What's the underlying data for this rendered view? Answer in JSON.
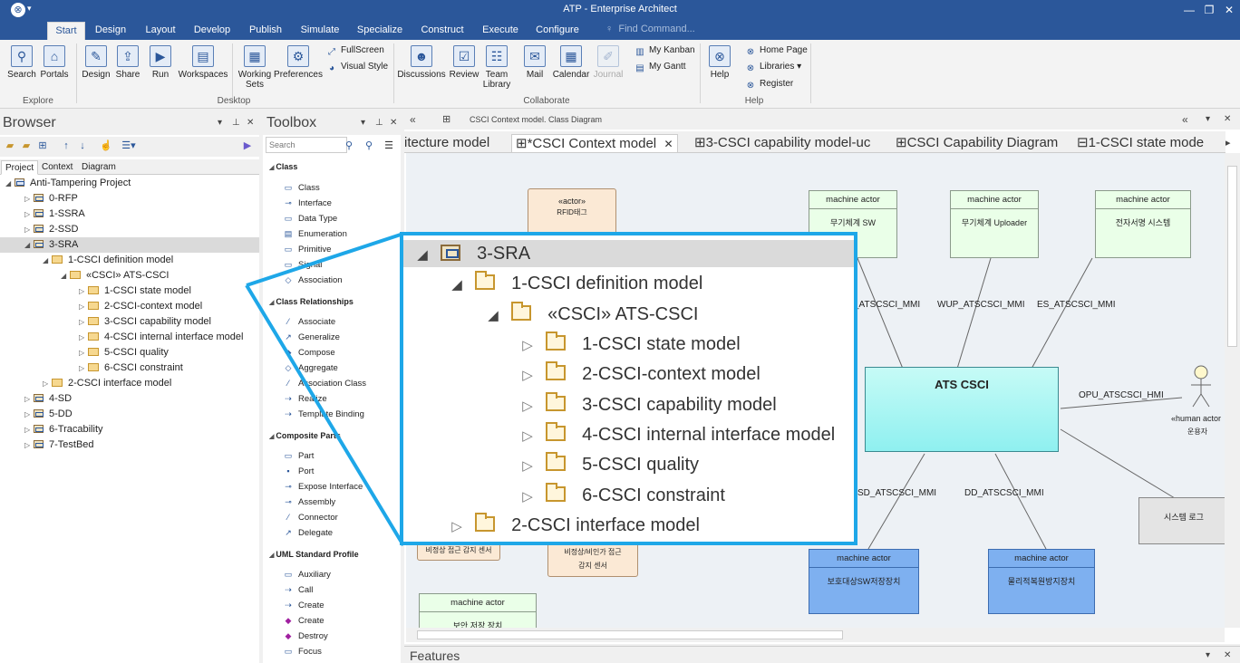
{
  "app": {
    "title": "ATP - Enterprise Architect",
    "find_placeholder": "Find Command...",
    "app_menu_icon": "ea-logo-icon"
  },
  "ribbon_tabs": [
    "Start",
    "Design",
    "Layout",
    "Develop",
    "Publish",
    "Simulate",
    "Specialize",
    "Construct",
    "Execute",
    "Configure"
  ],
  "ribbon": {
    "explore": {
      "label": "Explore",
      "search": "Search",
      "portals": "Portals"
    },
    "desktop": {
      "label": "Desktop",
      "design": "Design",
      "share": "Share",
      "run": "Run",
      "workspaces": "Workspaces",
      "working_sets": "Working Sets",
      "preferences": "Preferences",
      "fullscreen": "FullScreen",
      "visual_style": "Visual Style"
    },
    "collaborate": {
      "label": "Collaborate",
      "discussions": "Discussions",
      "review": "Review",
      "team_library": "Team Library",
      "mail": "Mail",
      "calendar": "Calendar",
      "journal": "Journal",
      "my_kanban": "My Kanban",
      "my_gantt": "My Gantt"
    },
    "help": {
      "label": "Help",
      "help": "Help",
      "home_page": "Home Page",
      "libraries": "Libraries",
      "register": "Register"
    }
  },
  "browser": {
    "title": "Browser",
    "tabs": [
      "Project",
      "Context",
      "Diagram"
    ],
    "tree": {
      "root": "Anti-Tampering Project",
      "rfp": "0-RFP",
      "ssra": "1-SSRA",
      "ssd": "2-SSD",
      "sra": "3-SRA",
      "csci_def": "1-CSCI definition model",
      "ats_csci": "«CSCI» ATS-CSCI",
      "state": "1-CSCI state model",
      "context": "2-CSCI-context model",
      "capability": "3-CSCI capability model",
      "internal": "4-CSCI internal interface model",
      "quality": "5-CSCI quality",
      "constraint": "6-CSCI constraint",
      "csci_if": "2-CSCI interface model",
      "sd": "4-SD",
      "dd": "5-DD",
      "trace": "6-Tracability",
      "testbed": "7-TestBed"
    }
  },
  "toolbox": {
    "title": "Toolbox",
    "search_placeholder": "Search",
    "sections": {
      "class": {
        "title": "Class",
        "items": [
          "Class",
          "Interface",
          "Data Type",
          "Enumeration",
          "Primitive",
          "Signal",
          "Association"
        ]
      },
      "class_rel": {
        "title": "Class Relationships",
        "items": [
          "Associate",
          "Generalize",
          "Compose",
          "Aggregate",
          "Association Class",
          "Realize",
          "Template Binding"
        ]
      },
      "composite": {
        "title": "Composite Parts",
        "items": [
          "Part",
          "Port",
          "Expose Interface",
          "Assembly",
          "Connector",
          "Delegate"
        ]
      },
      "uml": {
        "title": "UML Standard Profile",
        "items": [
          "Auxiliary",
          "Call",
          "Create",
          "Create",
          "Destroy",
          "Focus"
        ]
      }
    }
  },
  "diagram": {
    "breadcrumb": "CSCI Context model.  Class Diagram",
    "tabs": [
      "itecture model",
      "*CSCI Context model",
      "3-CSCI capability model-uc",
      "CSCI Capability Diagram",
      "1-CSCI state mode"
    ],
    "elements": {
      "actor_rfid_stereo": "«actor»",
      "actor_rfid_name": "RFID태그",
      "ma1_stereo": "machine actor",
      "ma1_name": "무기체계 SW",
      "ma2_stereo": "machine actor",
      "ma2_name": "무기체계 Uploader",
      "ma3_stereo": "machine actor",
      "ma3_name": "전자서명 시스템",
      "ats": "ATS CSCI",
      "human_actor": "«human actor",
      "human_name": "운용자",
      "log_box": "시스템 로그",
      "sensor1": "비정상 접근 감지 센서",
      "sensor2_l1": "비정상/비인가 접근",
      "sensor2_l2": "감지 센서",
      "ma4_stereo": "machine actor",
      "ma4_name": "보호대상SW저장장치",
      "ma5_stereo": "machine actor",
      "ma5_name": "물리적복원방지장치",
      "ma6_stereo": "machine actor",
      "ma6_name": "보안 저장 장치",
      "conn1": "_ATSCSCI_MMI",
      "conn2": "WUP_ATSCSCI_MMI",
      "conn3": "ES_ATSCSCI_MMI",
      "conn4": "OPU_ATSCSCI_HMI",
      "conn5": "SD_ATSCSCI_MMI",
      "conn6": "DD_ATSCSCI_MMI"
    }
  },
  "features": {
    "title": "Features"
  },
  "zoom": {
    "sra": "3-SRA",
    "csci_def": "1-CSCI definition model",
    "ats_csci": "«CSCI» ATS-CSCI",
    "state": "1-CSCI state model",
    "context": "2-CSCI-context model",
    "capability": "3-CSCI capability model",
    "internal": "4-CSCI internal interface model",
    "quality": "5-CSCI quality",
    "constraint": "6-CSCI constraint",
    "csci_if": "2-CSCI interface model"
  },
  "colors": {
    "accent": "#2b579a",
    "highlight": "#1ea7e8",
    "ats_fill": "#8ff0f0",
    "actor_fill": "#eaffe8",
    "blue_actor": "#7eb0f0"
  }
}
